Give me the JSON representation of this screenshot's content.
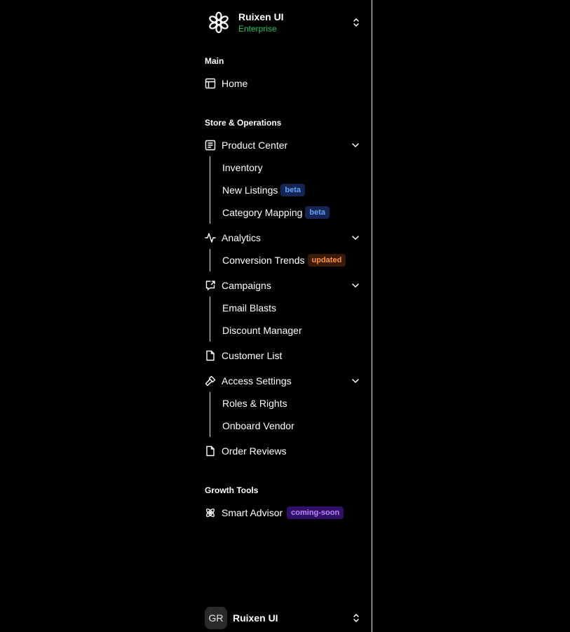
{
  "brand": {
    "name": "Ruixen UI",
    "plan": "Enterprise",
    "logo_icon": "snowflake-logo-icon"
  },
  "sections": {
    "main": "Main",
    "store": "Store & Operations",
    "growth": "Growth Tools"
  },
  "nav": {
    "home": "Home",
    "product_center": {
      "label": "Product Center",
      "sub": [
        "Inventory",
        "New Listings",
        "Category Mapping"
      ]
    },
    "analytics": {
      "label": "Analytics",
      "sub": [
        "Conversion Trends"
      ]
    },
    "campaigns": {
      "label": "Campaigns",
      "sub": [
        "Email Blasts",
        "Discount Manager"
      ]
    },
    "customer_list": "Customer List",
    "access_settings": {
      "label": "Access Settings",
      "sub": [
        "Roles & Rights",
        "Onboard Vendor"
      ]
    },
    "order_reviews": "Order Reviews",
    "smart_advisor": "Smart Advisor"
  },
  "badges": {
    "beta": "beta",
    "updated": "updated",
    "coming_soon": "coming-soon"
  },
  "user": {
    "initials": "GR",
    "name": "Ruixen UI"
  },
  "colors": {
    "accent_green": "#22c55e",
    "beta_blue": "#60a5fa",
    "updated_orange": "#fb923c",
    "soon_purple": "#c084fc"
  }
}
